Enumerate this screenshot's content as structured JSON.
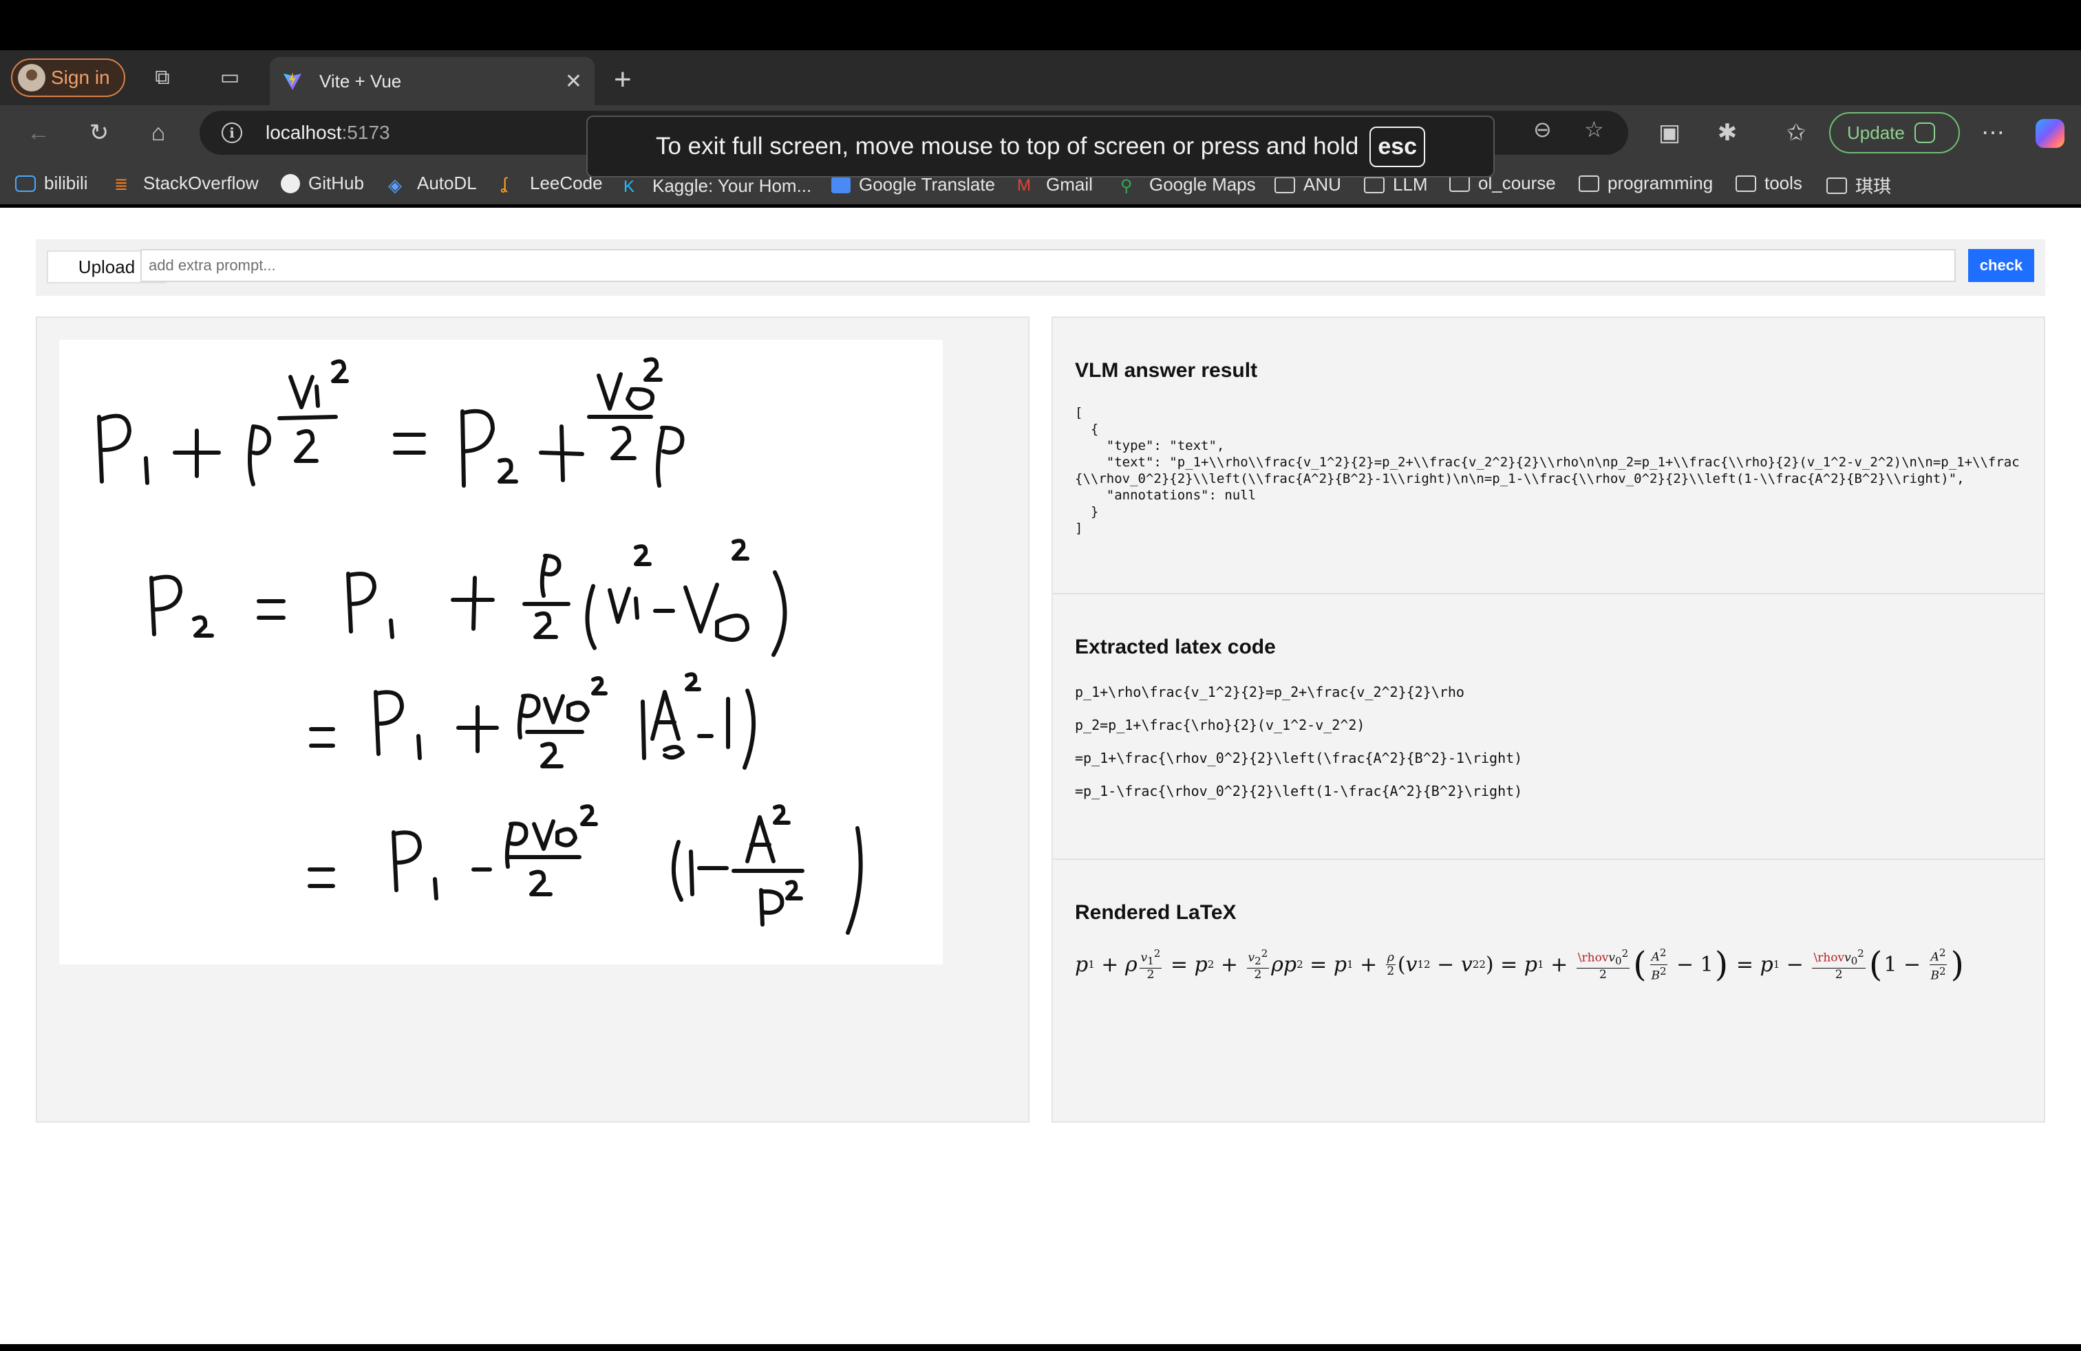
{
  "browser": {
    "signin_label": "Sign in",
    "tab_title": "Vite + Vue",
    "url_host": "localhost",
    "url_port": ":5173",
    "update_label": "Update",
    "fullscreen_notice": "To exit full screen, move mouse to top of screen or press and hold",
    "fullscreen_key": "esc",
    "bookmarks": [
      {
        "label": "bilibili",
        "icon": "bilibili-icon"
      },
      {
        "label": "StackOverflow",
        "icon": "stackoverflow-icon"
      },
      {
        "label": "GitHub",
        "icon": "github-icon"
      },
      {
        "label": "AutoDL",
        "icon": "autodl-icon"
      },
      {
        "label": "LeeCode",
        "icon": "leetcode-icon"
      },
      {
        "label": "Kaggle: Your Hom...",
        "icon": "kaggle-icon"
      },
      {
        "label": "Google Translate",
        "icon": "translate-icon"
      },
      {
        "label": "Gmail",
        "icon": "gmail-icon"
      },
      {
        "label": "Google Maps",
        "icon": "maps-icon"
      },
      {
        "label": "ANU",
        "icon": "folder-icon"
      },
      {
        "label": "LLM",
        "icon": "folder-icon"
      },
      {
        "label": "ol_course",
        "icon": "folder-icon"
      },
      {
        "label": "programming",
        "icon": "folder-icon"
      },
      {
        "label": "tools",
        "icon": "folder-icon"
      },
      {
        "label": "琪琪",
        "icon": "folder-icon"
      }
    ]
  },
  "app": {
    "upload_label": "Upload",
    "prompt_placeholder": "add extra prompt...",
    "prompt_value": "",
    "check_label": "check",
    "accent_color": "#1e6fff"
  },
  "vlm": {
    "title": "VLM answer result",
    "json_text": "[\n  {\n    \"type\": \"text\",\n    \"text\": \"p_1+\\\\rho\\\\frac{v_1^2}{2}=p_2+\\\\frac{v_2^2}{2}\\\\rho\\n\\np_2=p_1+\\\\frac{\\\\rho}{2}(v_1^2-v_2^2)\\n\\n=p_1+\\\\frac{\\\\rhov_0^2}{2}\\\\left(\\\\frac{A^2}{B^2}-1\\\\right)\\n\\n=p_1-\\\\frac{\\\\rhov_0^2}{2}\\\\left(1-\\\\frac{A^2}{B^2}\\\\right)\",\n    \"annotations\": null\n  }\n]"
  },
  "latex": {
    "title": "Extracted latex code",
    "lines": [
      "p_1+\\rho\\frac{v_1^2}{2}=p_2+\\frac{v_2^2}{2}\\rho",
      "p_2=p_1+\\frac{\\rho}{2}(v_1^2-v_2^2)",
      "=p_1+\\frac{\\rhov_0^2}{2}\\left(\\frac{A^2}{B^2}-1\\right)",
      "=p_1-\\frac{\\rhov_0^2}{2}\\left(1-\\frac{A^2}{B^2}\\right)"
    ]
  },
  "rendered": {
    "title": "Rendered LaTeX",
    "error_token": "\\rhov"
  }
}
